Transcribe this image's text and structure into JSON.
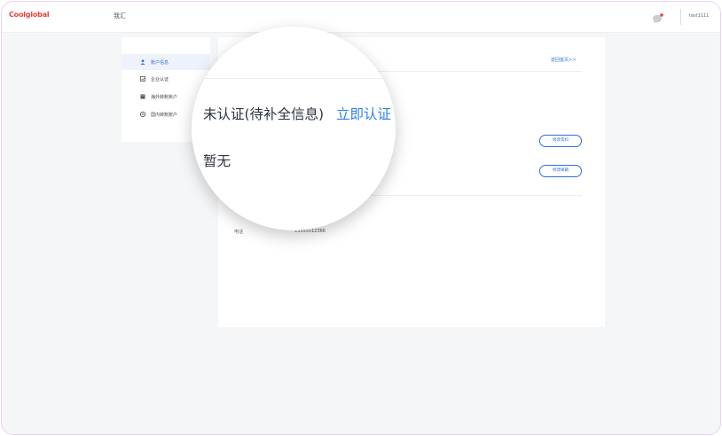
{
  "topbar": {
    "logo": "Coolglobal",
    "nav_title": "我汇",
    "username": "test1111"
  },
  "sidebar": {
    "items": [
      {
        "label": "账户信息",
        "icon": "user-icon",
        "active": true
      },
      {
        "label": "企业认证",
        "icon": "certificate-icon",
        "active": false
      },
      {
        "label": "海外转账账户",
        "icon": "building-icon",
        "active": false
      },
      {
        "label": "国内转账账户",
        "icon": "bank-icon",
        "active": false
      }
    ]
  },
  "main": {
    "back_link": "返回首页>>",
    "edit_profile_button": "修改资料",
    "edit_email_button": "修改邮箱",
    "phone_label": "电话",
    "phone_value": "15555512366"
  },
  "magnifier": {
    "status_text": "未认证(待补全信息)",
    "action_link": "立即认证",
    "none_text": "暂无"
  },
  "colors": {
    "accent": "#2f80ed",
    "logo": "#e8413b",
    "page_bg": "#f5f6f8"
  }
}
